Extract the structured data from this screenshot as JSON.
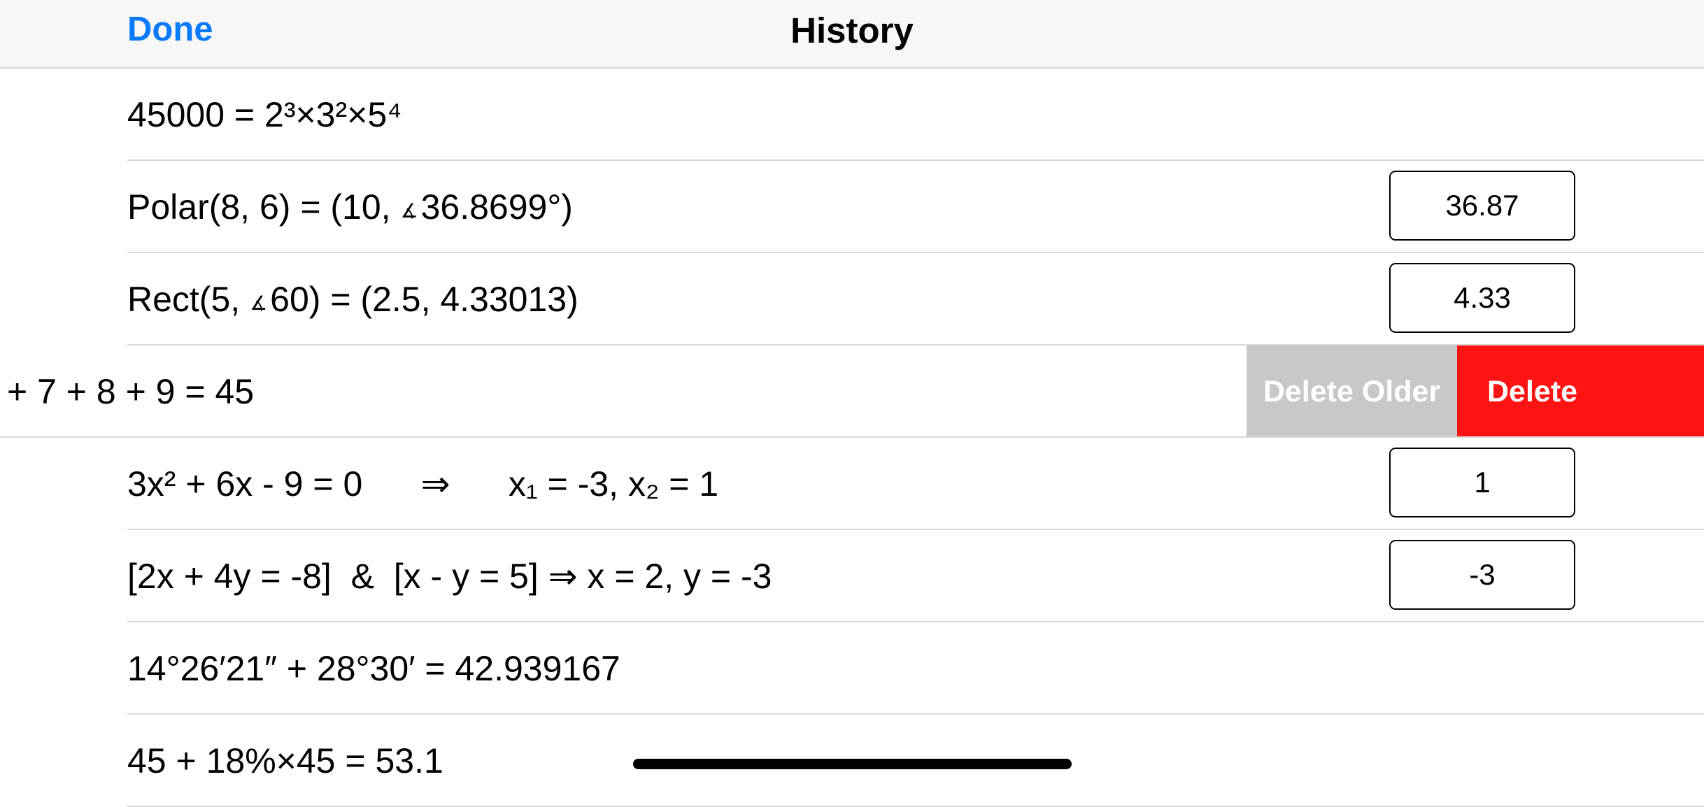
{
  "navbar": {
    "done_label": "Done",
    "title": "History"
  },
  "rows": [
    {
      "expression": "45000 = 2³×3²×5⁴"
    },
    {
      "prefix": "Polar(8, 6) = (10, ",
      "angle_symbol": "∡",
      "suffix": "36.8699°)",
      "value": "36.87"
    },
    {
      "prefix": "Rect(5, ",
      "angle_symbol": "∡",
      "suffix": "60) = (2.5, 4.33013)",
      "value": "4.33"
    },
    {
      "expression": "+ 7 + 8 + 9 = 45",
      "actions": {
        "delete_older": "Delete Older",
        "delete": "Delete"
      }
    },
    {
      "expression": "3x² + 6x - 9 = 0      ⇒      x₁ = -3, x₂ = 1",
      "value": "1"
    },
    {
      "expression": "[2x + 4y = -8]  &  [x - y = 5] ⇒ x = 2, y = -3",
      "value": "-3"
    },
    {
      "expression": "14°26′21″ + 28°30′ = 42.939167"
    },
    {
      "expression": "45 + 18%×45 = 53.1"
    }
  ]
}
